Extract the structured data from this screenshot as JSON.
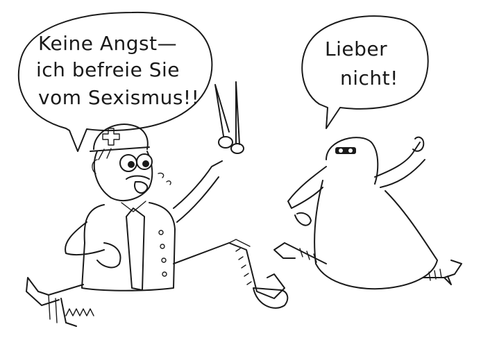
{
  "bubbles": {
    "left": {
      "line1": "Keine Angst—",
      "line2": "ich befreie Sie",
      "line3": "vom Sexismus!!"
    },
    "right": {
      "line1": "Lieber",
      "line2": "nicht!"
    }
  },
  "icons": {
    "helmet": "red-cross-helmet-icon",
    "tool": "scissors-icon"
  }
}
